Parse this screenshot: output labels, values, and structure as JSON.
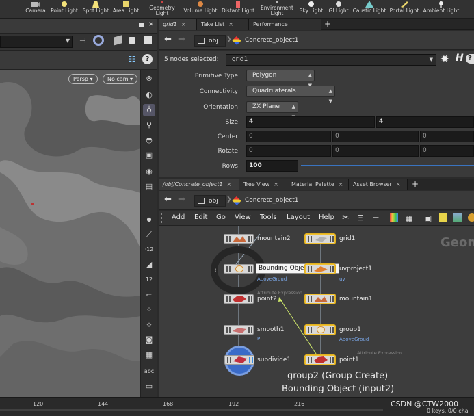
{
  "shelf": {
    "items": [
      {
        "label": "Camera",
        "icon": "camera-icon"
      },
      {
        "label": "Point Light",
        "icon": "point-light-icon"
      },
      {
        "label": "Spot Light",
        "icon": "spot-light-icon"
      },
      {
        "label": "Area Light",
        "icon": "area-light-icon"
      },
      {
        "label": "Geometry Light",
        "icon": "geometry-light-icon"
      },
      {
        "label": "Volume Light",
        "icon": "volume-light-icon"
      },
      {
        "label": "Distant Light",
        "icon": "distant-light-icon"
      },
      {
        "label": "Environment Light",
        "icon": "environment-light-icon"
      },
      {
        "label": "Sky Light",
        "icon": "sky-light-icon"
      },
      {
        "label": "GI Light",
        "icon": "gi-light-icon"
      },
      {
        "label": "Caustic Light",
        "icon": "caustic-light-icon"
      },
      {
        "label": "Portal Light",
        "icon": "portal-light-icon"
      },
      {
        "label": "Ambient Light",
        "icon": "ambient-light-icon"
      }
    ]
  },
  "viewport": {
    "persp_label": "Persp",
    "cam_label": "No cam"
  },
  "param_tabs": {
    "tabs": [
      "grid1",
      "Take List",
      "Performance Monitor"
    ],
    "plus": "+"
  },
  "param_path": {
    "root": "obj",
    "object": "Concrete_object1"
  },
  "params": {
    "selection_label": "5 nodes selected:",
    "selected_node": "grid1",
    "primitive_type": {
      "label": "Primitive Type",
      "value": "Polygon"
    },
    "connectivity": {
      "label": "Connectivity",
      "value": "Quadrilaterals"
    },
    "orientation": {
      "label": "Orientation",
      "value": "ZX Plane"
    },
    "size": {
      "label": "Size",
      "x": "4",
      "y": "4"
    },
    "center": {
      "label": "Center",
      "x": "0",
      "y": "0",
      "z": "0"
    },
    "rotate": {
      "label": "Rotate",
      "x": "0",
      "y": "0",
      "z": "0"
    },
    "rows": {
      "label": "Rows",
      "value": "100"
    }
  },
  "net_tabs": {
    "tabs": [
      "/obj/Concrete_object1",
      "Tree View",
      "Material Palette",
      "Asset Browser"
    ],
    "plus": "+"
  },
  "net_path": {
    "root": "obj",
    "object": "Concrete_object1"
  },
  "net_menu": {
    "items": [
      "Add",
      "Edit",
      "Go",
      "View",
      "Tools",
      "Layout",
      "Help"
    ]
  },
  "network": {
    "watermark": "Geom",
    "nodes": [
      {
        "name": "mountain2",
        "sub": "",
        "attr": ""
      },
      {
        "name": "point2",
        "sub": "",
        "attr": "Attribute Expression"
      },
      {
        "name": "smooth1",
        "sub": "P",
        "attr": ""
      },
      {
        "name": "subdivide1",
        "sub": "",
        "attr": ""
      },
      {
        "name": "grid1",
        "sub": "",
        "attr": ""
      },
      {
        "name": "uvproject1",
        "sub": "uv",
        "attr": ""
      },
      {
        "name": "mountain1",
        "sub": "",
        "attr": ""
      },
      {
        "name": "group1",
        "sub": "AboveGroud",
        "attr": ""
      },
      {
        "name": "point1",
        "sub": "",
        "attr": "Attribute Expression"
      }
    ],
    "tooltip": "Bounding Object (input2)",
    "group_sub": "AboveGroud",
    "caption_line1": "group2 (Group Create)",
    "caption_line2": "Bounding Object (input2)"
  },
  "timeline": {
    "ticks": [
      "120",
      "144",
      "168",
      "192",
      "216"
    ],
    "status": "0 keys, 0/0 cha",
    "watermark": "CSDN @CTW2000"
  },
  "colors": {
    "node_selected_border": "#f0c030",
    "wire": "#9fb0c0",
    "highlight_wire": "#cfe86a"
  }
}
